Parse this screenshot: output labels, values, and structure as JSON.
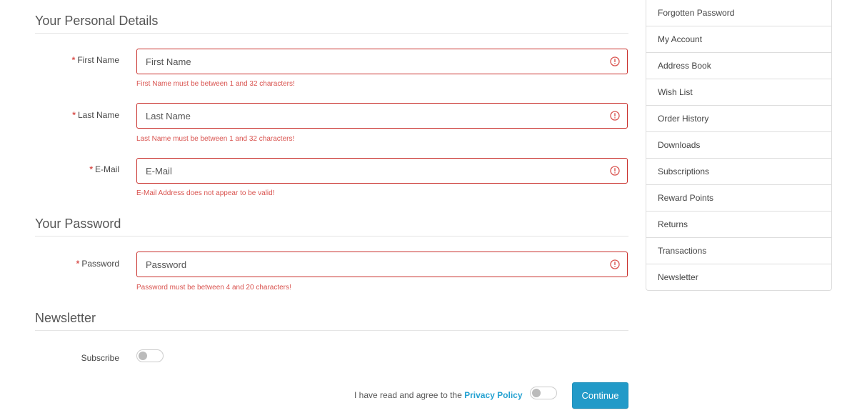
{
  "sections": {
    "personal": "Your Personal Details",
    "password": "Your Password",
    "newsletter": "Newsletter"
  },
  "fields": {
    "firstname": {
      "label": "First Name",
      "placeholder": "First Name",
      "error": "First Name must be between 1 and 32 characters!"
    },
    "lastname": {
      "label": "Last Name",
      "placeholder": "Last Name",
      "error": "Last Name must be between 1 and 32 characters!"
    },
    "email": {
      "label": "E-Mail",
      "placeholder": "E-Mail",
      "error": "E-Mail Address does not appear to be valid!"
    },
    "password": {
      "label": "Password",
      "placeholder": "Password",
      "error": "Password must be between 4 and 20 characters!"
    }
  },
  "required_marker": "*",
  "newsletter": {
    "subscribe_label": "Subscribe",
    "subscribed": false
  },
  "agree": {
    "text": "I have read and agree to the ",
    "link": "Privacy Policy",
    "checked": false
  },
  "buttons": {
    "continue": "Continue"
  },
  "sidebar": {
    "items": [
      {
        "label": "Forgotten Password"
      },
      {
        "label": "My Account"
      },
      {
        "label": "Address Book"
      },
      {
        "label": "Wish List"
      },
      {
        "label": "Order History"
      },
      {
        "label": "Downloads"
      },
      {
        "label": "Subscriptions"
      },
      {
        "label": "Reward Points"
      },
      {
        "label": "Returns"
      },
      {
        "label": "Transactions"
      },
      {
        "label": "Newsletter"
      }
    ]
  },
  "colors": {
    "error": "#d9534f",
    "accent": "#229ac8",
    "link": "#23a1d1"
  },
  "icons": {
    "field_error": "exclamation-circle-icon"
  }
}
